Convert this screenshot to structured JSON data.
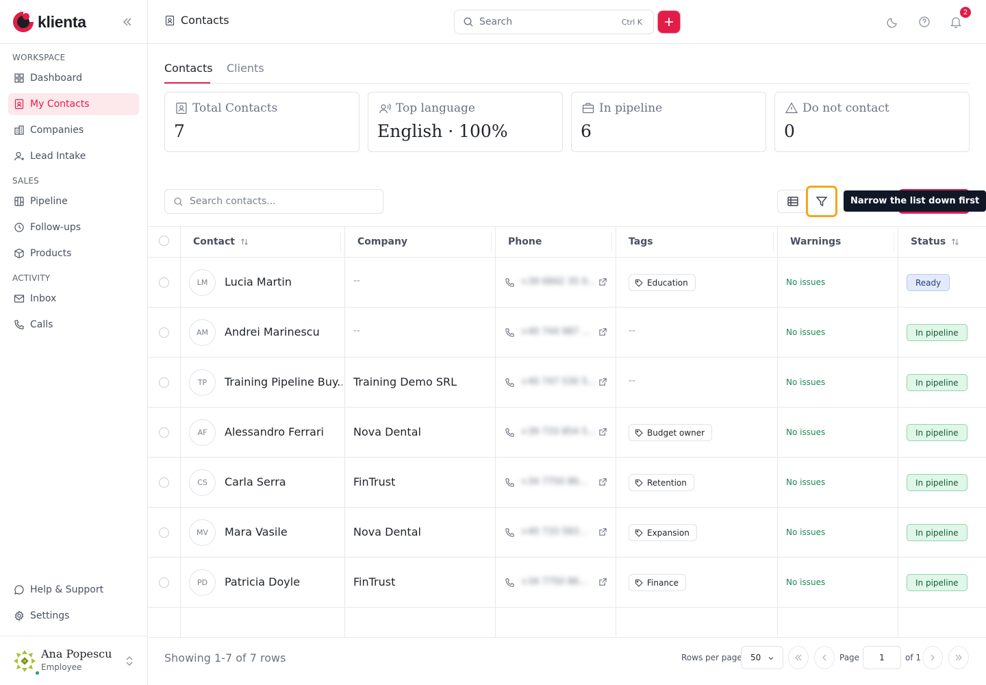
{
  "brand": {
    "name": "klienta",
    "accent": "#e11d48"
  },
  "sidebar": {
    "sections": [
      {
        "title": "WORKSPACE",
        "items": [
          {
            "label": "Dashboard",
            "icon": "dashboard-icon"
          },
          {
            "label": "My Contacts",
            "icon": "contact-icon",
            "active": true
          },
          {
            "label": "Companies",
            "icon": "building-icon"
          },
          {
            "label": "Lead Intake",
            "icon": "user-plus-icon"
          }
        ]
      },
      {
        "title": "SALES",
        "items": [
          {
            "label": "Pipeline",
            "icon": "pipeline-icon"
          },
          {
            "label": "Follow-ups",
            "icon": "clock-icon"
          },
          {
            "label": "Products",
            "icon": "box-icon"
          }
        ]
      },
      {
        "title": "ACTIVITY",
        "items": [
          {
            "label": "Inbox",
            "icon": "mail-icon"
          },
          {
            "label": "Calls",
            "icon": "phone-icon"
          }
        ]
      }
    ],
    "bottom": [
      {
        "label": "Help & Support",
        "icon": "chat-icon"
      },
      {
        "label": "Settings",
        "icon": "gear-icon"
      }
    ],
    "user": {
      "name": "Ana Popescu",
      "role": "Employee"
    }
  },
  "topbar": {
    "title": "Contacts",
    "search_placeholder": "Search",
    "search_shortcut": "Ctrl K",
    "notification_count": "2"
  },
  "tabs": [
    {
      "label": "Contacts",
      "active": true
    },
    {
      "label": "Clients",
      "active": false
    }
  ],
  "stats": [
    {
      "label": "Total Contacts",
      "value": "7",
      "icon": "contact-card-icon"
    },
    {
      "label": "Top language",
      "value": "English · 100%",
      "icon": "speaking-icon"
    },
    {
      "label": "In pipeline",
      "value": "6",
      "icon": "briefcase-icon"
    },
    {
      "label": "Do not contact",
      "value": "0",
      "icon": "warning-icon"
    }
  ],
  "toolbar": {
    "search_placeholder": "Search contacts...",
    "tooltip": "Narrow the list down first"
  },
  "table": {
    "columns": [
      "Contact",
      "Company",
      "Phone",
      "Tags",
      "Warnings",
      "Status"
    ],
    "rows": [
      {
        "initials": "LM",
        "name": "Lucia Martin",
        "company": "--",
        "phone": "+39 6842 35 0...",
        "tag": "Education",
        "warning": "No issues",
        "status": "Ready"
      },
      {
        "initials": "AM",
        "name": "Andrei Marinescu",
        "company": "--",
        "phone": "+40 744 987 ...",
        "tag": "--",
        "warning": "No issues",
        "status": "In pipeline"
      },
      {
        "initials": "TP",
        "name": "Training Pipeline Buy...",
        "company": "Training Demo SRL",
        "phone": "+40 747 530 5...",
        "tag": "--",
        "warning": "No issues",
        "status": "In pipeline"
      },
      {
        "initials": "AF",
        "name": "Alessandro Ferrari",
        "company": "Nova Dental",
        "phone": "+39 733 854 5...",
        "tag": "Budget owner",
        "warning": "No issues",
        "status": "In pipeline"
      },
      {
        "initials": "CS",
        "name": "Carla Serra",
        "company": "FinTrust",
        "phone": "+34 7750 86...",
        "tag": "Retention",
        "warning": "No issues",
        "status": "In pipeline"
      },
      {
        "initials": "MV",
        "name": "Mara Vasile",
        "company": "Nova Dental",
        "phone": "+40 733 583...",
        "tag": "Expansion",
        "warning": "No issues",
        "status": "In pipeline"
      },
      {
        "initials": "PD",
        "name": "Patricia Doyle",
        "company": "FinTrust",
        "phone": "+34 7750 86...",
        "tag": "Finance",
        "warning": "No issues",
        "status": "In pipeline"
      }
    ]
  },
  "footer": {
    "showing": "Showing 1-7 of 7 rows",
    "rows_per_page_label": "Rows per page",
    "rows_per_page": "50",
    "page_label": "Page",
    "page": "1",
    "of_label": "of 1"
  }
}
